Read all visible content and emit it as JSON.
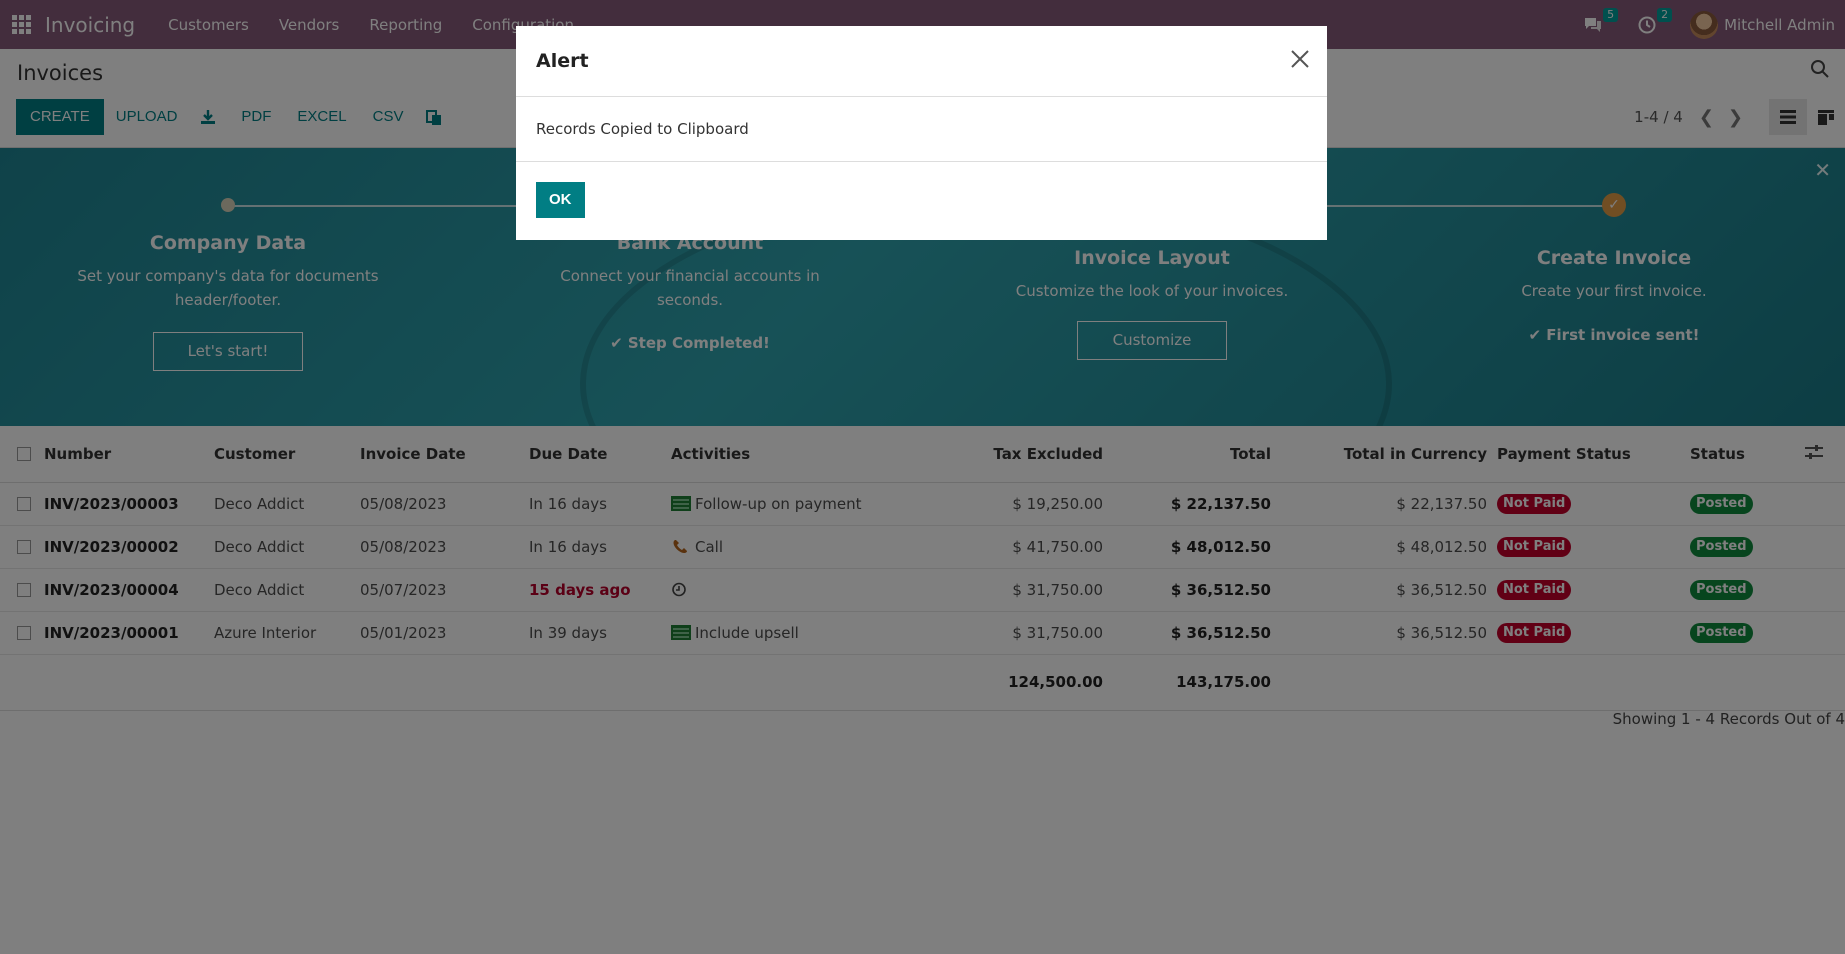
{
  "navbar": {
    "brand": "Invoicing",
    "menu": [
      "Customers",
      "Vendors",
      "Reporting",
      "Configuration"
    ],
    "messages_count": "5",
    "activities_count": "2",
    "user_name": "Mitchell Admin"
  },
  "control": {
    "title": "Invoices",
    "buttons": {
      "create": "CREATE",
      "upload": "UPLOAD",
      "pdf": "PDF",
      "excel": "EXCEL",
      "csv": "CSV"
    },
    "pager": "1-4 / 4"
  },
  "banner": {
    "steps": [
      {
        "title": "Company Data",
        "desc": "Set your company's data for documents header/footer.",
        "action": "Let's start!"
      },
      {
        "title": "Bank Account",
        "desc": "Connect your financial accounts in seconds.",
        "action": "Step Completed!"
      },
      {
        "title": "Invoice Layout",
        "desc": "Customize the look of your invoices.",
        "action": "Customize"
      },
      {
        "title": "Create Invoice",
        "desc": "Create your first invoice.",
        "action": "First invoice sent!"
      }
    ]
  },
  "table": {
    "headers": [
      "Number",
      "Customer",
      "Invoice Date",
      "Due Date",
      "Activities",
      "Tax Excluded",
      "Total",
      "Total in Currency",
      "Payment Status",
      "Status"
    ],
    "rows": [
      {
        "number": "INV/2023/00003",
        "customer": "Deco Addict",
        "invoice_date": "05/08/2023",
        "due_date": "In 16 days",
        "activity": "Follow-up on payment",
        "tax_excluded": "$ 19,250.00",
        "total": "$ 22,137.50",
        "total_currency": "$ 22,137.50",
        "payment_status": "Not Paid",
        "status": "Posted"
      },
      {
        "number": "INV/2023/00002",
        "customer": "Deco Addict",
        "invoice_date": "05/08/2023",
        "due_date": "In 16 days",
        "activity": "Call",
        "tax_excluded": "$ 41,750.00",
        "total": "$ 48,012.50",
        "total_currency": "$ 48,012.50",
        "payment_status": "Not Paid",
        "status": "Posted"
      },
      {
        "number": "INV/2023/00004",
        "customer": "Deco Addict",
        "invoice_date": "05/07/2023",
        "due_date": "15 days ago",
        "activity": "",
        "tax_excluded": "$ 31,750.00",
        "total": "$ 36,512.50",
        "total_currency": "$ 36,512.50",
        "payment_status": "Not Paid",
        "status": "Posted"
      },
      {
        "number": "INV/2023/00001",
        "customer": "Azure Interior",
        "invoice_date": "05/01/2023",
        "due_date": "In 39 days",
        "activity": "Include upsell",
        "tax_excluded": "$ 31,750.00",
        "total": "$ 36,512.50",
        "total_currency": "$ 36,512.50",
        "payment_status": "Not Paid",
        "status": "Posted"
      }
    ],
    "totals": {
      "tax_excluded": "124,500.00",
      "total": "143,175.00"
    },
    "footer": "Showing 1 - 4 Records Out of 4"
  },
  "modal": {
    "title": "Alert",
    "message": "Records Copied to Clipboard",
    "ok": "OK"
  },
  "colors": {
    "navbar": "#875a7b",
    "primary": "#017e84",
    "danger": "#c2002b",
    "success": "#0e8a3c"
  }
}
